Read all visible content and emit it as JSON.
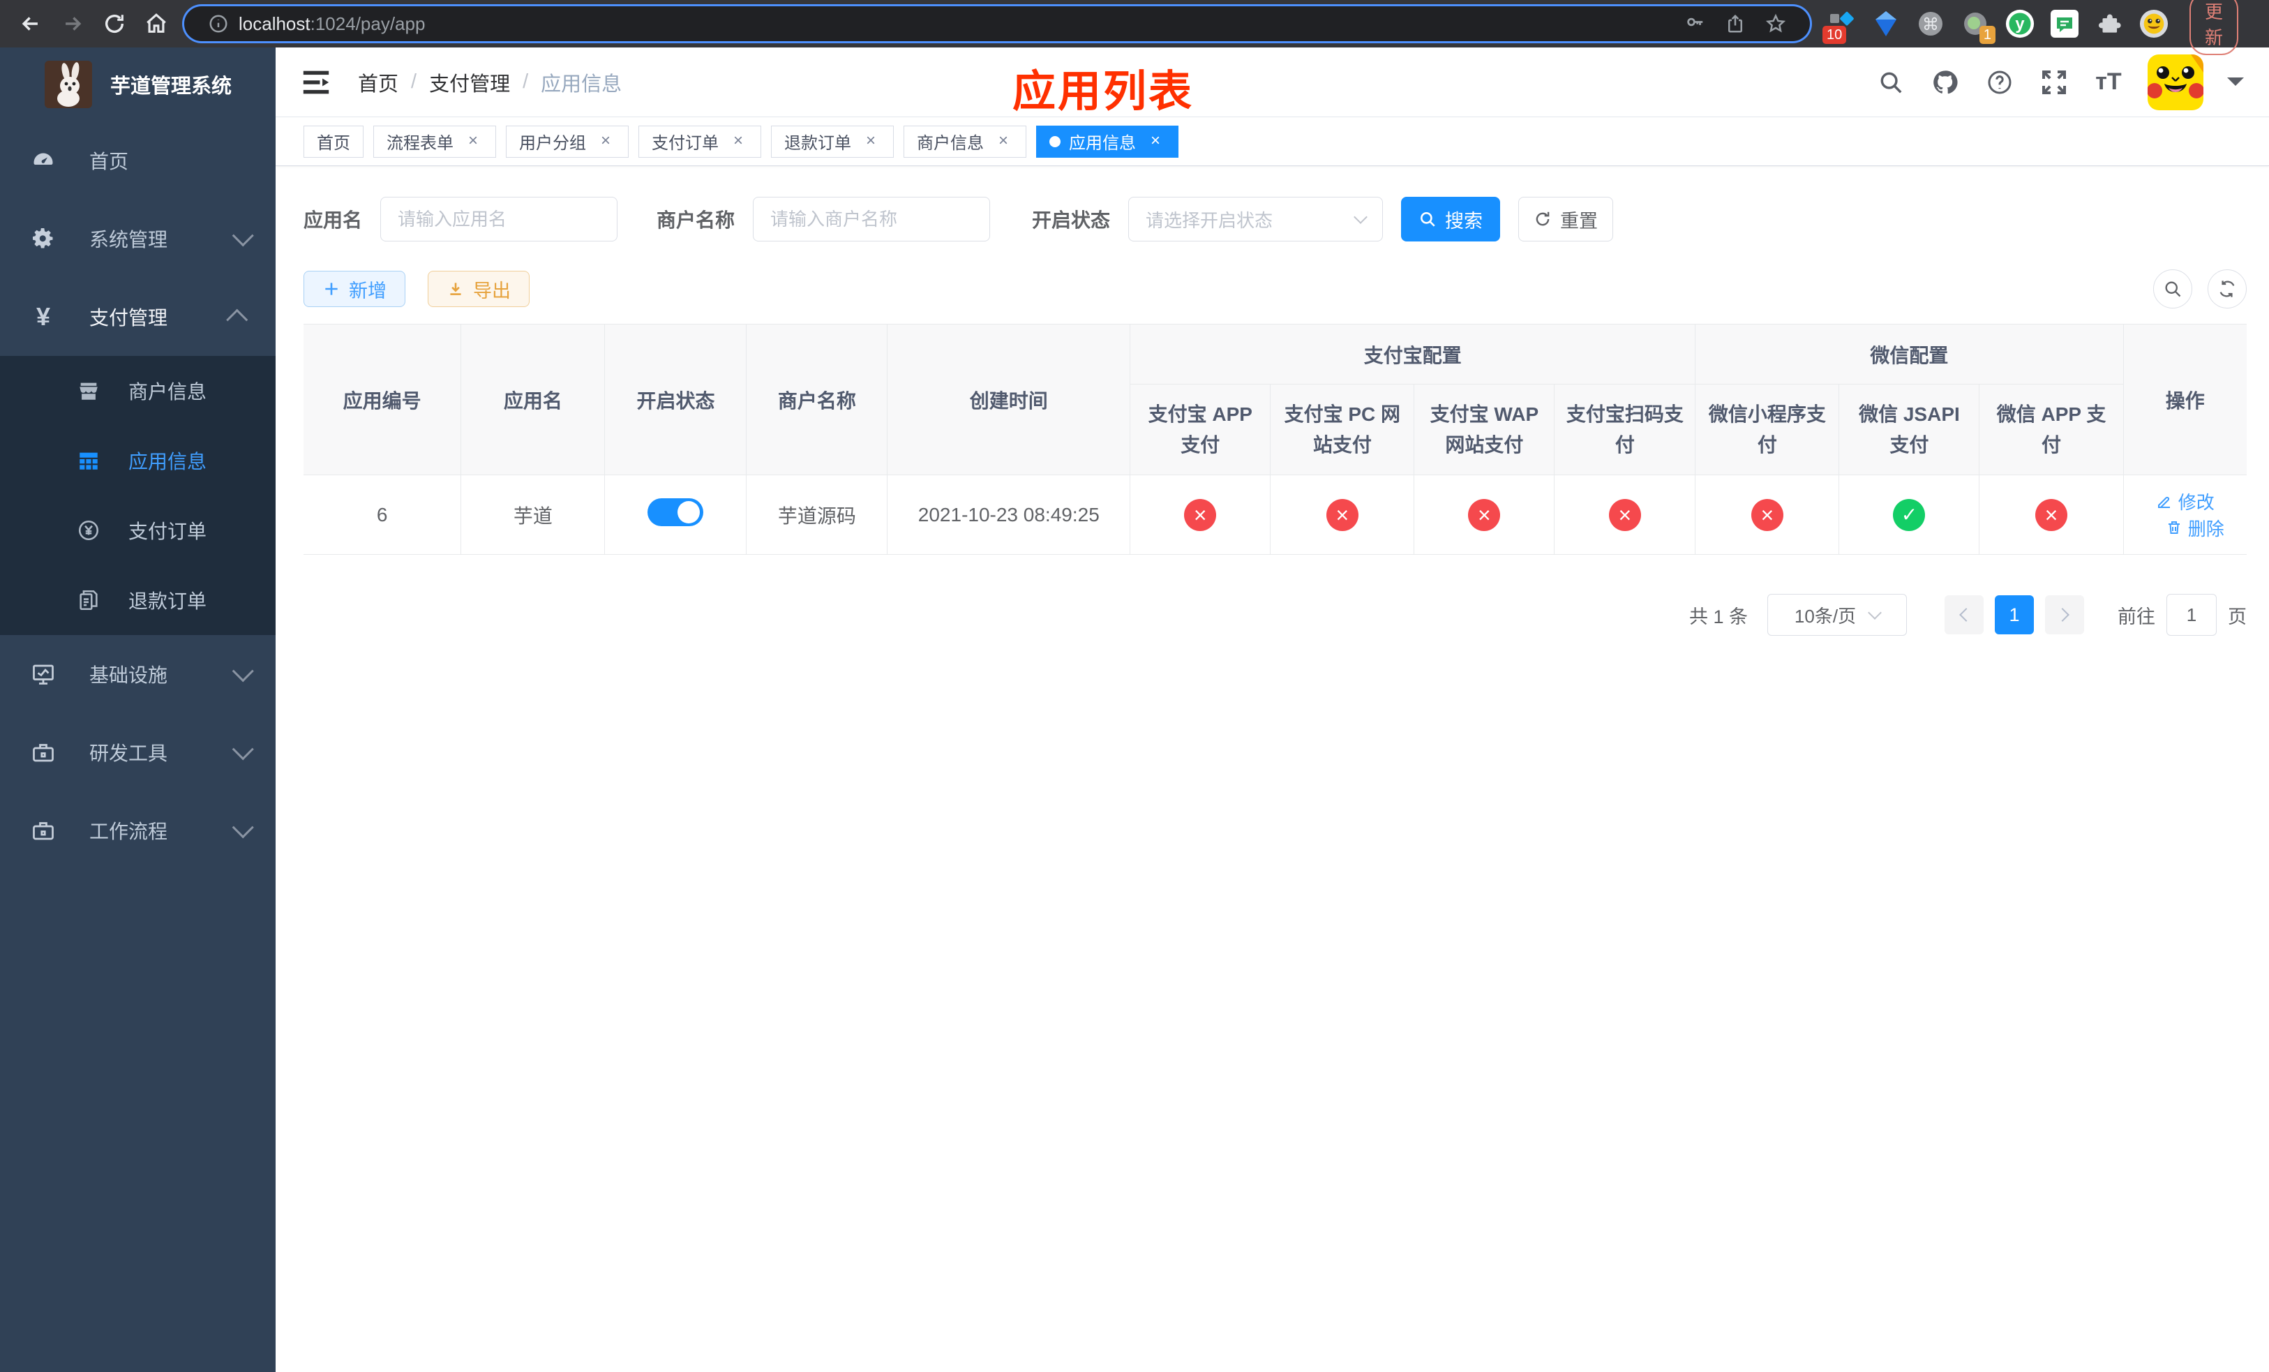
{
  "browser": {
    "url_host": "localhost",
    "url_path": ":1024/pay/app",
    "update_label": "更新",
    "ext_badge_1": "10",
    "ext_badge_2": "1",
    "kebab": "⋮"
  },
  "sidebar": {
    "title": "芋道管理系统",
    "items": [
      {
        "label": "首页"
      },
      {
        "label": "系统管理"
      },
      {
        "label": "支付管理"
      },
      {
        "label": "基础设施"
      },
      {
        "label": "研发工具"
      },
      {
        "label": "工作流程"
      }
    ],
    "submenu": [
      {
        "label": "商户信息"
      },
      {
        "label": "应用信息"
      },
      {
        "label": "支付订单"
      },
      {
        "label": "退款订单"
      }
    ]
  },
  "header": {
    "breadcrumb": [
      "首页",
      "支付管理",
      "应用信息"
    ],
    "annotation": "应用列表"
  },
  "tags": [
    {
      "label": "首页"
    },
    {
      "label": "流程表单"
    },
    {
      "label": "用户分组"
    },
    {
      "label": "支付订单"
    },
    {
      "label": "退款订单"
    },
    {
      "label": "商户信息"
    },
    {
      "label": "应用信息"
    }
  ],
  "filters": {
    "app_name_label": "应用名",
    "app_name_placeholder": "请输入应用名",
    "merchant_label": "商户名称",
    "merchant_placeholder": "请输入商户名称",
    "status_label": "开启状态",
    "status_placeholder": "请选择开启状态",
    "search_label": "搜索",
    "reset_label": "重置"
  },
  "toolbar": {
    "add_label": "新增",
    "export_label": "导出"
  },
  "table": {
    "columns": [
      "应用编号",
      "应用名",
      "开启状态",
      "商户名称",
      "创建时间"
    ],
    "groups": [
      {
        "label": "支付宝配置",
        "children": [
          "支付宝 APP 支付",
          "支付宝 PC 网站支付",
          "支付宝 WAP 网站支付",
          "支付宝扫码支付"
        ]
      },
      {
        "label": "微信配置",
        "children": [
          "微信小程序支付",
          "微信 JSAPI 支付",
          "微信 APP 支付"
        ]
      }
    ],
    "action_col": "操作",
    "rows": [
      {
        "id": "6",
        "name": "芋道",
        "status": true,
        "merchant": "芋道源码",
        "created": "2021-10-23 08:49:25",
        "pay_status": [
          false,
          false,
          false,
          false,
          false,
          true,
          false
        ],
        "actions": [
          "修改",
          "删除"
        ]
      }
    ]
  },
  "pagination": {
    "total": "共 1 条",
    "page_size": "10条/页",
    "current": "1",
    "goto_label": "前往",
    "goto_value": "1",
    "page_label": "页"
  },
  "colors": {
    "primary": "#1890ff",
    "link": "#409eff",
    "success": "#13ce66",
    "danger": "#f5494d",
    "warning": "#e6a23c",
    "annotation": "#ff3000",
    "sidebar_bg": "#304156",
    "submenu_bg": "#1f2d3d"
  }
}
